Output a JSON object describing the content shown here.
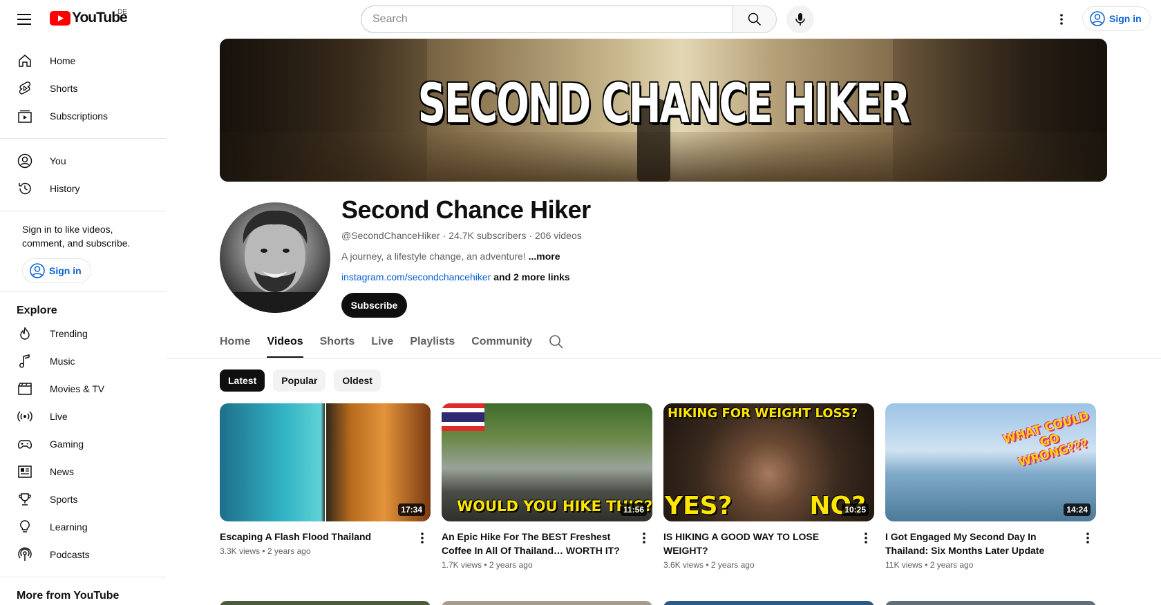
{
  "header": {
    "logo_text": "YouTube",
    "country_code": "DE",
    "search_placeholder": "Search",
    "signin_label": "Sign in"
  },
  "sidebar": {
    "primary": [
      {
        "label": "Home",
        "icon": "home-icon"
      },
      {
        "label": "Shorts",
        "icon": "shorts-icon"
      },
      {
        "label": "Subscriptions",
        "icon": "subscriptions-icon"
      }
    ],
    "secondary": [
      {
        "label": "You",
        "icon": "you-icon"
      },
      {
        "label": "History",
        "icon": "history-icon"
      }
    ],
    "signin_prompt": "Sign in to like videos, comment, and subscribe.",
    "signin_label": "Sign in",
    "explore_title": "Explore",
    "explore": [
      {
        "label": "Trending",
        "icon": "trending-icon"
      },
      {
        "label": "Music",
        "icon": "music-icon"
      },
      {
        "label": "Movies & TV",
        "icon": "movies-icon"
      },
      {
        "label": "Live",
        "icon": "live-icon"
      },
      {
        "label": "Gaming",
        "icon": "gaming-icon"
      },
      {
        "label": "News",
        "icon": "news-icon"
      },
      {
        "label": "Sports",
        "icon": "sports-icon"
      },
      {
        "label": "Learning",
        "icon": "learning-icon"
      },
      {
        "label": "Podcasts",
        "icon": "podcasts-icon"
      }
    ],
    "more_title": "More from YouTube"
  },
  "channel": {
    "banner_title": "SECOND CHANCE HIKER",
    "name": "Second Chance Hiker",
    "handle": "@SecondChanceHiker",
    "subscribers": "24.7K subscribers",
    "videos_count": "206 videos",
    "separator": "·",
    "description": "A journey, a lifestyle change, an adventure!",
    "more_label": "...more",
    "link": "instagram.com/secondchancehiker",
    "more_links": "and 2 more links",
    "subscribe_label": "Subscribe"
  },
  "tabs": [
    "Home",
    "Videos",
    "Shorts",
    "Live",
    "Playlists",
    "Community"
  ],
  "active_tab": "Videos",
  "chips": [
    "Latest",
    "Popular",
    "Oldest"
  ],
  "active_chip": "Latest",
  "videos": [
    {
      "title": "Escaping A Flash Flood Thailand",
      "views": "3.3K views",
      "age": "2 years ago",
      "duration": "17:34",
      "caption": ""
    },
    {
      "title": "An Epic Hike For The BEST Freshest Coffee In All Of Thailand… WORTH IT?",
      "views": "1.7K views",
      "age": "2 years ago",
      "duration": "11:56",
      "caption": "WOULD YOU HIKE THIS?"
    },
    {
      "title": "IS HIKING A GOOD WAY TO LOSE WEIGHT?",
      "views": "3.6K views",
      "age": "2 years ago",
      "duration": "10:25",
      "caption": "HIKING FOR WEIGHT LOSS?",
      "caption_yes": "YES?",
      "caption_no": "NO?"
    },
    {
      "title": "I Got Engaged My Second Day In Thailand: Six Months Later Update",
      "views": "11K views",
      "age": "2 years ago",
      "duration": "14:24",
      "caption": "WHAT COULD GO WRONG???"
    }
  ],
  "colors": {
    "brand_red": "#ff0000",
    "link_blue": "#065fd4",
    "text_primary": "#0f0f0f",
    "text_secondary": "#606060"
  }
}
